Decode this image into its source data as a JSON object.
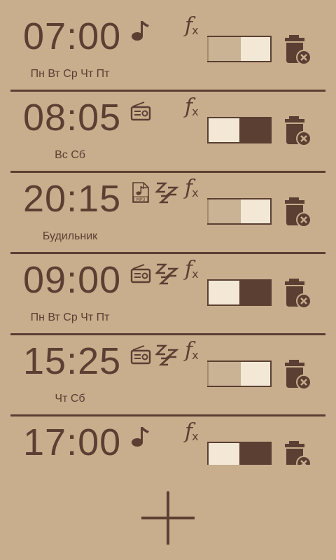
{
  "alarms": [
    {
      "time": "07:00",
      "days": "Пн Вт Ср Чт Пт",
      "sound_icon": "music-note-icon",
      "snooze": false,
      "enabled": false
    },
    {
      "time": "08:05",
      "days": "Вс Сб",
      "sound_icon": "radio-icon",
      "snooze": false,
      "enabled": true
    },
    {
      "time": "20:15",
      "days": "Будильник",
      "sound_icon": "mp3-file-icon",
      "snooze": true,
      "enabled": false
    },
    {
      "time": "09:00",
      "days": "Пн Вт Ср Чт Пт",
      "sound_icon": "radio-icon",
      "snooze": true,
      "enabled": true
    },
    {
      "time": "15:25",
      "days": "Чт Сб",
      "sound_icon": "radio-icon",
      "snooze": true,
      "enabled": false
    },
    {
      "time": "17:00",
      "days": "",
      "sound_icon": "music-note-icon",
      "snooze": false,
      "enabled": true
    }
  ],
  "colors": {
    "background": "#c8ae8c",
    "foreground": "#5b3f33",
    "switch_track": "#f3e8d6",
    "switch_off_thumb": "#c9b394"
  },
  "icons": {
    "effects": "fx-icon",
    "delete": "trash-delete-icon",
    "add": "plus-icon",
    "snooze": "zzz-icon"
  },
  "fx_label": "f",
  "fx_sub": "x",
  "mp3_label": "MP3"
}
